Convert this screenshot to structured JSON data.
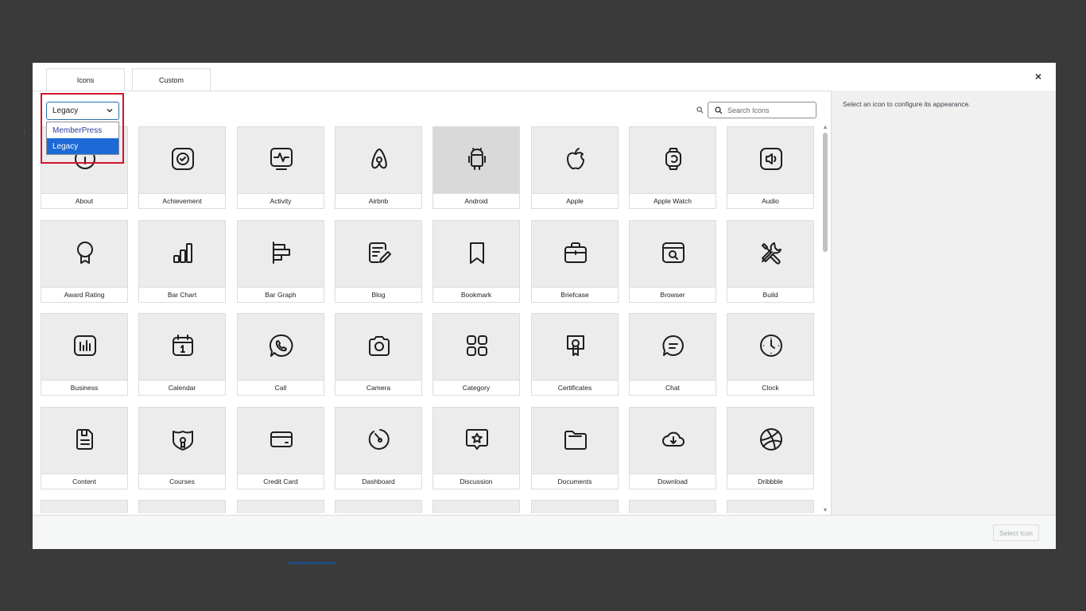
{
  "tabs": [
    {
      "label": "Icons"
    },
    {
      "label": "Custom"
    }
  ],
  "close_icon": "×",
  "library_select": {
    "selected": "Legacy",
    "options": [
      "MemberPress",
      "Legacy"
    ],
    "highlighted_option": "Legacy",
    "highlight_color": "#d3122f"
  },
  "search": {
    "placeholder": "Search Icons",
    "value": ""
  },
  "sidebar": {
    "message": "Select an icon to configure its appearance."
  },
  "footer": {
    "select_button": "Select Icon"
  },
  "icons": [
    {
      "label": "About",
      "icon": "info-circle-icon"
    },
    {
      "label": "Achievement",
      "icon": "badge-check-icon"
    },
    {
      "label": "Activity",
      "icon": "activity-pulse-icon"
    },
    {
      "label": "Airbnb",
      "icon": "airbnb-icon"
    },
    {
      "label": "Android",
      "icon": "android-icon",
      "active": true
    },
    {
      "label": "Apple",
      "icon": "apple-icon"
    },
    {
      "label": "Apple Watch",
      "icon": "apple-watch-icon"
    },
    {
      "label": "Audio",
      "icon": "audio-speaker-icon"
    },
    {
      "label": "Award Rating",
      "icon": "award-ribbon-icon"
    },
    {
      "label": "Bar Chart",
      "icon": "bar-chart-icon"
    },
    {
      "label": "Bar Graph",
      "icon": "bar-graph-icon"
    },
    {
      "label": "Blog",
      "icon": "blog-edit-icon"
    },
    {
      "label": "Bookmark",
      "icon": "bookmark-icon"
    },
    {
      "label": "Briefcase",
      "icon": "briefcase-icon"
    },
    {
      "label": "Browser",
      "icon": "browser-search-icon"
    },
    {
      "label": "Build",
      "icon": "tools-icon"
    },
    {
      "label": "Business",
      "icon": "business-chart-icon"
    },
    {
      "label": "Calendar",
      "icon": "calendar-icon"
    },
    {
      "label": "Call",
      "icon": "phone-bubble-icon"
    },
    {
      "label": "Camera",
      "icon": "camera-icon"
    },
    {
      "label": "Category",
      "icon": "category-grid-icon"
    },
    {
      "label": "Certificates",
      "icon": "certificate-icon"
    },
    {
      "label": "Chat",
      "icon": "chat-bubble-icon"
    },
    {
      "label": "Clock",
      "icon": "clock-icon"
    },
    {
      "label": "Content",
      "icon": "content-doc-icon"
    },
    {
      "label": "Courses",
      "icon": "courses-shield-icon"
    },
    {
      "label": "Credit Card",
      "icon": "credit-card-icon"
    },
    {
      "label": "Dashboard",
      "icon": "dashboard-gauge-icon"
    },
    {
      "label": "Discussion",
      "icon": "discussion-star-icon"
    },
    {
      "label": "Documents",
      "icon": "folder-icon"
    },
    {
      "label": "Download",
      "icon": "cloud-download-icon"
    },
    {
      "label": "Dribbble",
      "icon": "dribbble-ball-icon"
    }
  ]
}
